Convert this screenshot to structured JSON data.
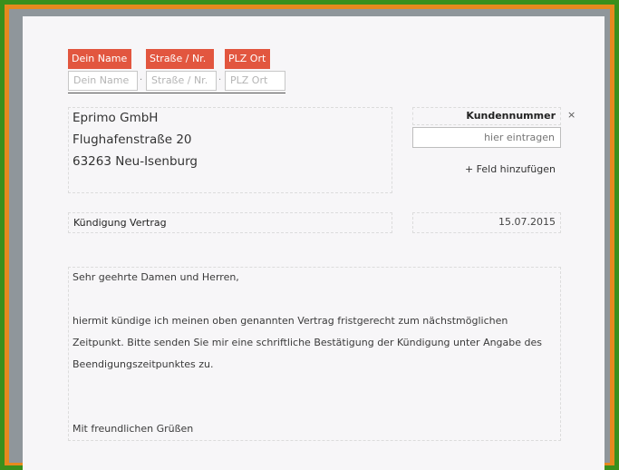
{
  "sender": {
    "tags": [
      "Dein Name",
      "Straße / Nr.",
      "PLZ Ort"
    ],
    "placeholders": [
      "Dein Name",
      "Straße / Nr.",
      "PLZ Ort"
    ],
    "separator": "·"
  },
  "recipient": {
    "lines": [
      "Eprimo GmbH",
      "Flughafenstraße 20",
      "63263 Neu-Isenburg"
    ]
  },
  "customer_number": {
    "label": "Kundennummer",
    "placeholder": "hier eintragen",
    "remove_label": "×",
    "add_field_label": "+ Feld hinzufügen"
  },
  "subject": "Kündigung Vertrag",
  "date": "15.07.2015",
  "letter": {
    "salutation": "Sehr geehrte Damen und Herren,",
    "body": [
      "hiermit kündige ich meinen oben genannten Vertrag fristgerecht zum nächstmöglichen",
      "Zeitpunkt. Bitte senden Sie mir eine schriftliche Bestätigung der Kündigung unter Angabe des",
      "Beendigungszeitpunktes zu."
    ],
    "closing": "Mit freundlichen Grüßen"
  }
}
